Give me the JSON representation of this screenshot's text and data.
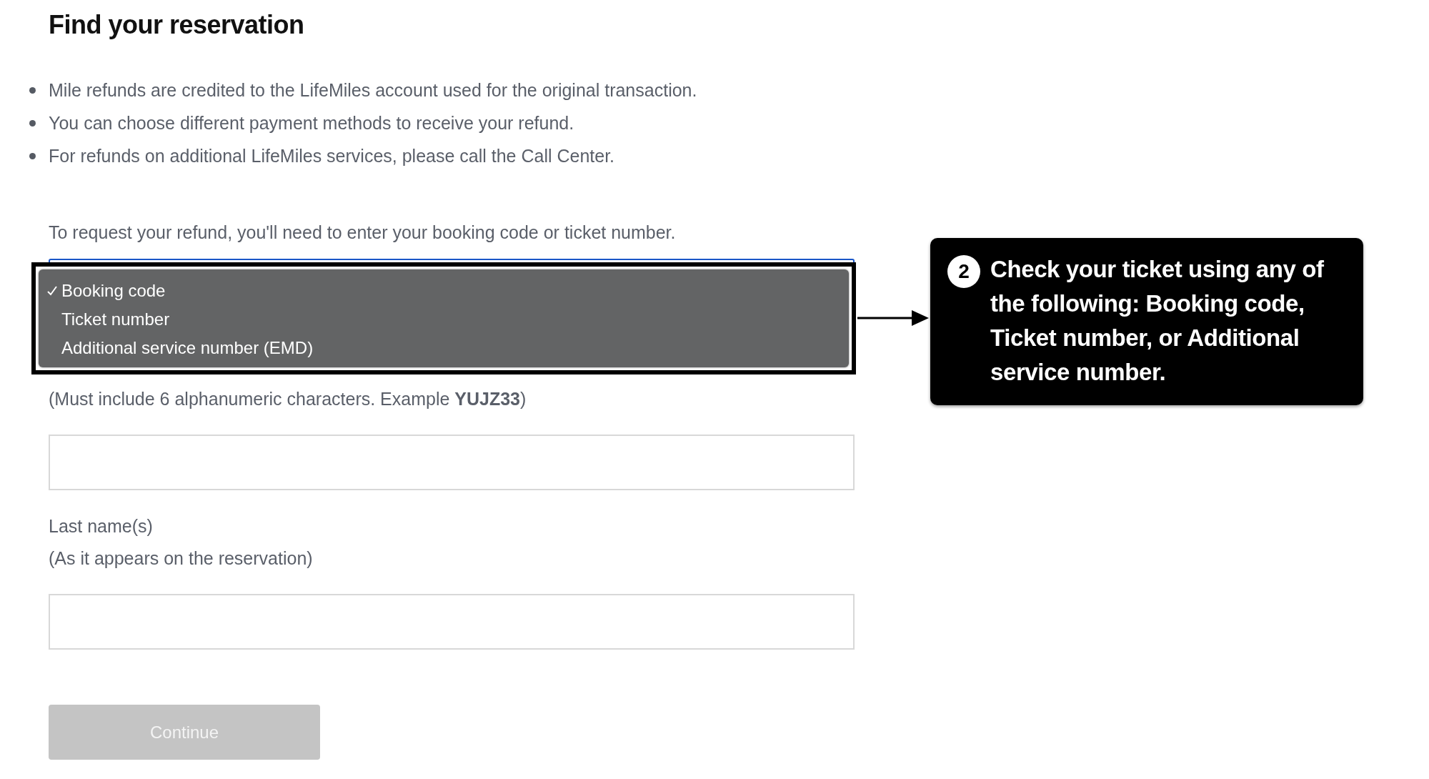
{
  "heading": "Find your reservation",
  "bullets": [
    "Mile refunds are credited to the LifeMiles account used for the original transaction.",
    "You can choose different payment methods to receive your refund.",
    "For refunds on additional LifeMiles services, please call the Call Center."
  ],
  "intro": "To request your refund, you'll need to enter your booking code or ticket number.",
  "lookup_menu": {
    "options": [
      {
        "label": "Booking code",
        "selected": true
      },
      {
        "label": "Ticket number",
        "selected": false
      },
      {
        "label": "Additional service number (EMD)",
        "selected": false
      }
    ]
  },
  "code_hint": "(Must include 6 alphanumeric characters. Example **YUJZ33**)",
  "last_name": {
    "label": "Last name(s)",
    "hint": "(As it appears on the reservation)"
  },
  "continue_button": {
    "label": "Continue",
    "disabled": true
  },
  "callout": {
    "number": "2",
    "text": "Check your ticket using any of the following: Booking code, Ticket number, or Additional service number."
  }
}
